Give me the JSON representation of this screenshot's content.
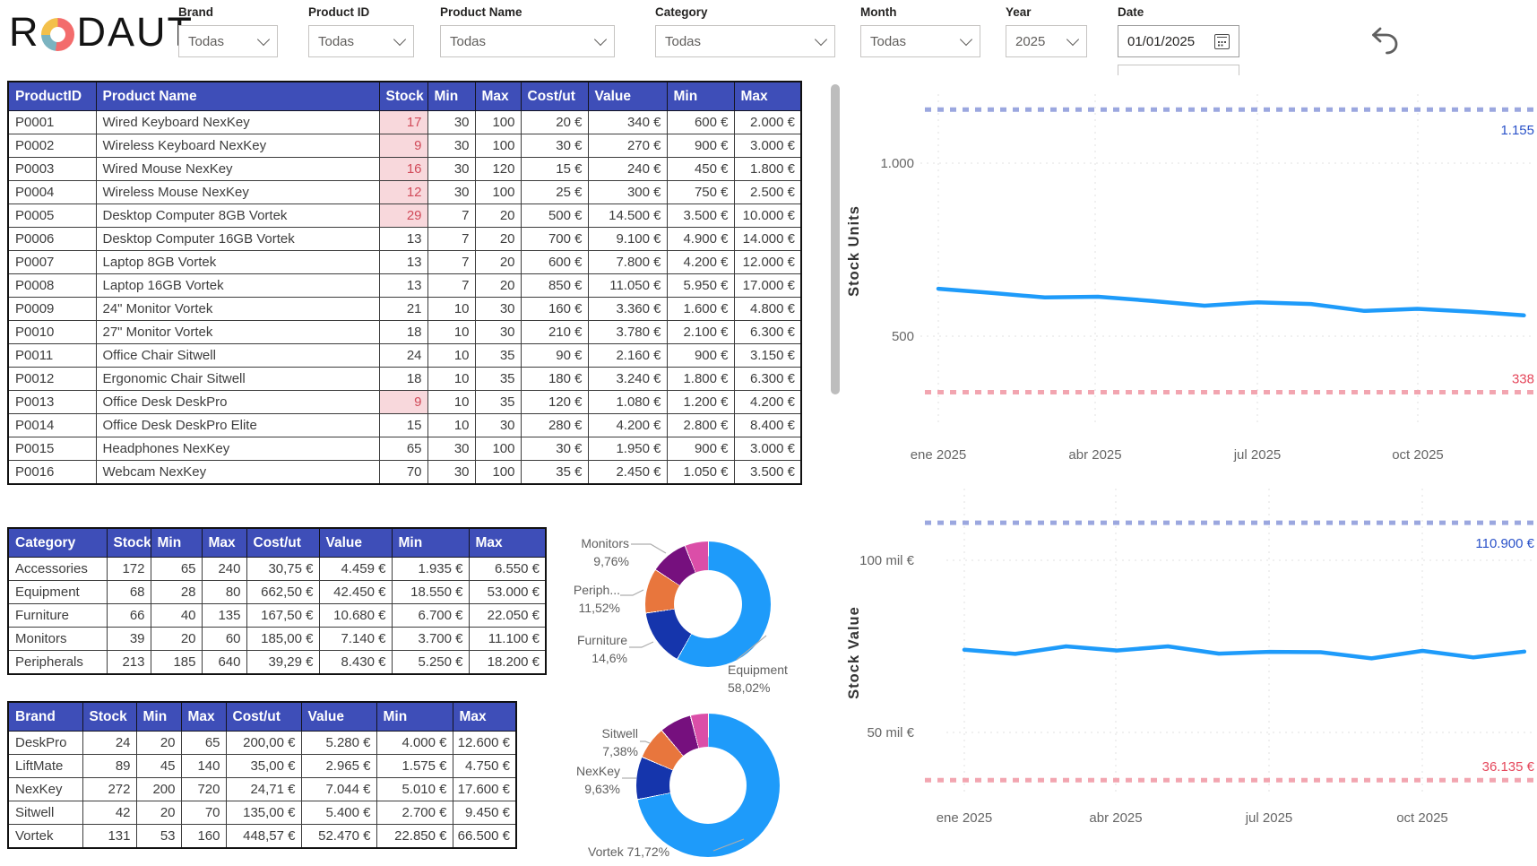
{
  "logo": {
    "left": "R",
    "right": "DAUT"
  },
  "filters": [
    {
      "label": "Brand",
      "value": "Todas"
    },
    {
      "label": "Product ID",
      "value": "Todas"
    },
    {
      "label": "Product Name",
      "value": "Todas"
    },
    {
      "label": "Category",
      "value": "Todas"
    },
    {
      "label": "Month",
      "value": "Todas"
    },
    {
      "label": "Year",
      "value": "2025"
    },
    {
      "label": "Date",
      "value": "01/01/2025"
    }
  ],
  "colors": {
    "table_header": "#3E4EB8",
    "alert_bg": "#F8D8DC",
    "alert_text": "#D14B5A",
    "series_blue": "#1E9BFA",
    "ref_max_line": "#9BA7DF",
    "ref_max_text": "#2A52C9",
    "ref_min_line": "#F2A5B0",
    "ref_min_text": "#E5485C"
  },
  "products_table": {
    "headers": [
      "ProductID",
      "Product Name",
      "Stock",
      "Min",
      "Max",
      "Cost/ut",
      "Value",
      "Min",
      "Max"
    ],
    "rows": [
      {
        "cells": [
          "P0001",
          "Wired Keyboard NexKey",
          "17",
          "30",
          "100",
          "20 €",
          "340 €",
          "600 €",
          "2.000 €"
        ],
        "alert": true
      },
      {
        "cells": [
          "P0002",
          "Wireless Keyboard NexKey",
          "9",
          "30",
          "100",
          "30 €",
          "270 €",
          "900 €",
          "3.000 €"
        ],
        "alert": true
      },
      {
        "cells": [
          "P0003",
          "Wired Mouse NexKey",
          "16",
          "30",
          "120",
          "15 €",
          "240 €",
          "450 €",
          "1.800 €"
        ],
        "alert": true
      },
      {
        "cells": [
          "P0004",
          "Wireless Mouse NexKey",
          "12",
          "30",
          "100",
          "25 €",
          "300 €",
          "750 €",
          "2.500 €"
        ],
        "alert": true
      },
      {
        "cells": [
          "P0005",
          "Desktop Computer 8GB Vortek",
          "29",
          "7",
          "20",
          "500 €",
          "14.500 €",
          "3.500 €",
          "10.000 €"
        ],
        "alert": true
      },
      {
        "cells": [
          "P0006",
          "Desktop Computer 16GB Vortek",
          "13",
          "7",
          "20",
          "700 €",
          "9.100 €",
          "4.900 €",
          "14.000 €"
        ],
        "alert": false
      },
      {
        "cells": [
          "P0007",
          "Laptop 8GB Vortek",
          "13",
          "7",
          "20",
          "600 €",
          "7.800 €",
          "4.200 €",
          "12.000 €"
        ],
        "alert": false
      },
      {
        "cells": [
          "P0008",
          "Laptop 16GB Vortek",
          "13",
          "7",
          "20",
          "850 €",
          "11.050 €",
          "5.950 €",
          "17.000 €"
        ],
        "alert": false
      },
      {
        "cells": [
          "P0009",
          "24\" Monitor Vortek",
          "21",
          "10",
          "30",
          "160 €",
          "3.360 €",
          "1.600 €",
          "4.800 €"
        ],
        "alert": false
      },
      {
        "cells": [
          "P0010",
          "27\" Monitor Vortek",
          "18",
          "10",
          "30",
          "210 €",
          "3.780 €",
          "2.100 €",
          "6.300 €"
        ],
        "alert": false
      },
      {
        "cells": [
          "P0011",
          "Office Chair Sitwell",
          "24",
          "10",
          "35",
          "90 €",
          "2.160 €",
          "900 €",
          "3.150 €"
        ],
        "alert": false
      },
      {
        "cells": [
          "P0012",
          "Ergonomic Chair Sitwell",
          "18",
          "10",
          "35",
          "180 €",
          "3.240 €",
          "1.800 €",
          "6.300 €"
        ],
        "alert": false
      },
      {
        "cells": [
          "P0013",
          "Office Desk DeskPro",
          "9",
          "10",
          "35",
          "120 €",
          "1.080 €",
          "1.200 €",
          "4.200 €"
        ],
        "alert": true
      },
      {
        "cells": [
          "P0014",
          "Office Desk DeskPro Elite",
          "15",
          "10",
          "30",
          "280 €",
          "4.200 €",
          "2.800 €",
          "8.400 €"
        ],
        "alert": false
      },
      {
        "cells": [
          "P0015",
          "Headphones NexKey",
          "65",
          "30",
          "100",
          "30 €",
          "1.950 €",
          "900 €",
          "3.000 €"
        ],
        "alert": false
      },
      {
        "cells": [
          "P0016",
          "Webcam NexKey",
          "70",
          "30",
          "100",
          "35 €",
          "2.450 €",
          "1.050 €",
          "3.500 €"
        ],
        "alert": false
      }
    ]
  },
  "category_table": {
    "headers": [
      "Category",
      "Stock",
      "Min",
      "Max",
      "Cost/ut",
      "Value",
      "Min",
      "Max"
    ],
    "rows": [
      {
        "cells": [
          "Accessories",
          "172",
          "65",
          "240",
          "30,75 €",
          "4.459 €",
          "1.935 €",
          "6.550 €"
        ]
      },
      {
        "cells": [
          "Equipment",
          "68",
          "28",
          "80",
          "662,50 €",
          "42.450 €",
          "18.550 €",
          "53.000 €"
        ]
      },
      {
        "cells": [
          "Furniture",
          "66",
          "40",
          "135",
          "167,50 €",
          "10.680 €",
          "6.700 €",
          "22.050 €"
        ]
      },
      {
        "cells": [
          "Monitors",
          "39",
          "20",
          "60",
          "185,00 €",
          "7.140 €",
          "3.700 €",
          "11.100 €"
        ]
      },
      {
        "cells": [
          "Peripherals",
          "213",
          "185",
          "640",
          "39,29 €",
          "8.430 €",
          "5.250 €",
          "18.200 €"
        ]
      }
    ]
  },
  "brand_table": {
    "headers": [
      "Brand",
      "Stock",
      "Min",
      "Max",
      "Cost/ut",
      "Value",
      "Min",
      "Max"
    ],
    "rows": [
      {
        "cells": [
          "DeskPro",
          "24",
          "20",
          "65",
          "200,00 €",
          "5.280 €",
          "4.000 €",
          "12.600 €"
        ]
      },
      {
        "cells": [
          "LiftMate",
          "89",
          "45",
          "140",
          "35,00 €",
          "2.965 €",
          "1.575 €",
          "4.750 €"
        ]
      },
      {
        "cells": [
          "NexKey",
          "272",
          "200",
          "720",
          "24,71 €",
          "7.044 €",
          "5.010 €",
          "17.600 €"
        ]
      },
      {
        "cells": [
          "Sitwell",
          "42",
          "20",
          "70",
          "135,00 €",
          "5.400 €",
          "2.700 €",
          "9.450 €"
        ]
      },
      {
        "cells": [
          "Vortek",
          "131",
          "53",
          "160",
          "448,57 €",
          "52.470 €",
          "22.850 €",
          "66.500 €"
        ]
      }
    ]
  },
  "chart_data": [
    {
      "type": "line",
      "title": "",
      "ylabel": "Stock Units",
      "xlabel": "",
      "x": [
        "ene 2025",
        "feb 2025",
        "mar 2025",
        "abr 2025",
        "may 2025",
        "jun 2025",
        "jul 2025",
        "ago 2025",
        "sep 2025",
        "oct 2025",
        "nov 2025",
        "dic 2025"
      ],
      "x_shown_ticks": [
        "ene 2025",
        "abr 2025",
        "jul 2025",
        "oct 2025"
      ],
      "series": [
        {
          "name": "Stock Units",
          "values": [
            637,
            625,
            612,
            614,
            602,
            588,
            598,
            593,
            573,
            579,
            571,
            560
          ]
        }
      ],
      "yticks": [
        {
          "v": 500,
          "label": "500"
        },
        {
          "v": 1000,
          "label": "1.000"
        }
      ],
      "ref_max": {
        "v": 1155,
        "label": "1.155"
      },
      "ref_min": {
        "v": 338,
        "label": "338"
      },
      "ylim": [
        250,
        1250
      ],
      "grid": true,
      "legend": "none"
    },
    {
      "type": "line",
      "title": "",
      "ylabel": "Stock Value",
      "xlabel": "",
      "x": [
        "ene 2025",
        "feb 2025",
        "mar 2025",
        "abr 2025",
        "may 2025",
        "jun 2025",
        "jul 2025",
        "ago 2025",
        "sep 2025",
        "oct 2025",
        "nov 2025",
        "dic 2025"
      ],
      "x_shown_ticks": [
        "ene 2025",
        "abr 2025",
        "jul 2025",
        "oct 2025"
      ],
      "series": [
        {
          "name": "Stock Value (€)",
          "values": [
            74000,
            72800,
            75000,
            73800,
            75000,
            72900,
            73400,
            73300,
            71500,
            73700,
            71800,
            73500
          ]
        }
      ],
      "yticks": [
        {
          "v": 50000,
          "label": "50 mil €"
        },
        {
          "v": 100000,
          "label": "100 mil €"
        }
      ],
      "ref_max": {
        "v": 110900,
        "label": "110.900 €"
      },
      "ref_min": {
        "v": 36135,
        "label": "36.135 €"
      },
      "ylim": [
        25000,
        125000
      ],
      "grid": true,
      "legend": "none"
    },
    {
      "type": "pie",
      "title": "Stock Value by Category",
      "slices": [
        {
          "name": "Equipment",
          "pct": 58.02,
          "color": "#1E9BFA"
        },
        {
          "name": "Furniture",
          "pct": 14.6,
          "color": "#1535AC"
        },
        {
          "name": "Peripherals",
          "pct": 11.52,
          "color": "#E8763D"
        },
        {
          "name": "Monitors",
          "pct": 9.76,
          "color": "#76107E"
        },
        {
          "name": "Accessories",
          "pct": 6.1,
          "color": "#DB4EA8"
        }
      ],
      "callouts": {
        "monitors": [
          "Monitors",
          "9,76%"
        ],
        "peripherals": [
          "Periph...",
          "11,52%"
        ],
        "furniture": [
          "Furniture",
          "14,6%"
        ],
        "equipment": [
          "Equipment",
          "58,02%"
        ]
      }
    },
    {
      "type": "pie",
      "title": "Stock Value by Brand",
      "slices": [
        {
          "name": "Vortek",
          "pct": 71.72,
          "color": "#1E9BFA"
        },
        {
          "name": "NexKey",
          "pct": 9.63,
          "color": "#1535AC"
        },
        {
          "name": "Sitwell",
          "pct": 7.38,
          "color": "#E8763D"
        },
        {
          "name": "DeskPro",
          "pct": 7.22,
          "color": "#76107E"
        },
        {
          "name": "LiftMate",
          "pct": 4.05,
          "color": "#DB4EA8"
        }
      ],
      "callouts": {
        "sitwell": [
          "Sitwell",
          "7,38%"
        ],
        "nexkey": [
          "NexKey",
          "9,63%"
        ],
        "vortek": [
          "Vortek 71,72%"
        ]
      }
    }
  ]
}
